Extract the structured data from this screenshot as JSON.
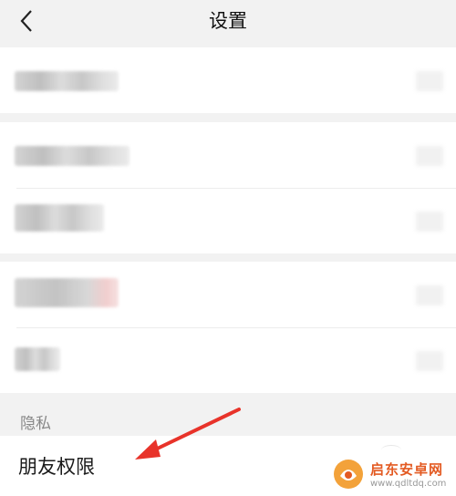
{
  "header": {
    "title": "设置",
    "back_icon": "chevron-left-icon"
  },
  "groups": [
    {
      "rows": [
        {
          "label": "",
          "blurred": true
        }
      ]
    },
    {
      "rows": [
        {
          "label": "",
          "blurred": true
        },
        {
          "label": "",
          "blurred": true
        }
      ]
    },
    {
      "rows": [
        {
          "label": "",
          "blurred": true
        },
        {
          "label": "",
          "blurred": true
        }
      ]
    }
  ],
  "privacy": {
    "section_label": "隐私",
    "friend_permission_label": "朋友权限"
  },
  "annotation": {
    "type": "red-arrow",
    "color": "#e8332a"
  },
  "watermark": {
    "brand": "启东安卓网",
    "url": "www.qdltdq.com",
    "brand_color": "#e35a22"
  }
}
